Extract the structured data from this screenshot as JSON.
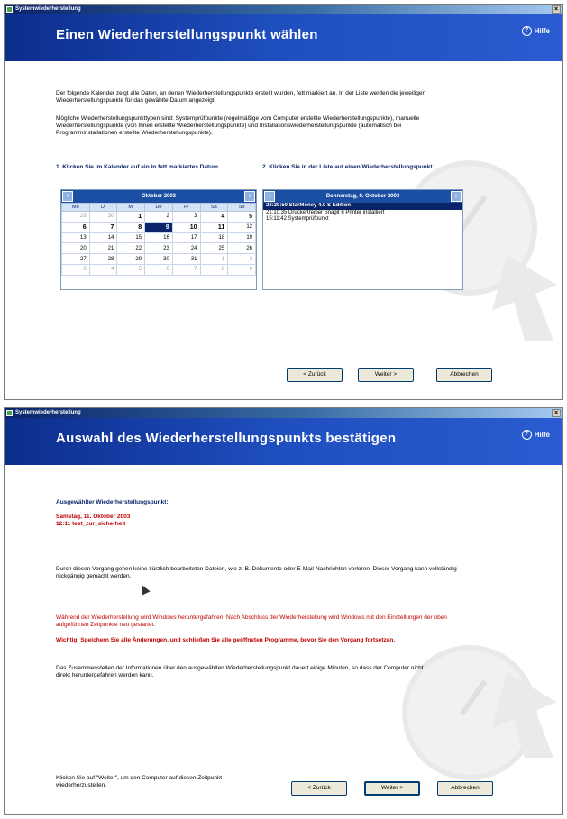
{
  "window1": {
    "titlebar": "Systemwiederherstellung",
    "close": "×",
    "header_title": "Einen Wiederherstellungspunkt wählen",
    "help_label": "Hilfe",
    "intro1": "Der folgende Kalender zeigt alle Daten, an denen Wiederherstellungspunkte erstellt wurden, fett markiert an. In der Liste werden die jeweiligen Wiederherstellungspunkte für das gewählte Datum angezeigt.",
    "intro2": "Mögliche Wiederherstellungspunkttypen sind: Systemprüfpunkte (regelmäßige vom Computer erstellte Wiederherstellungspunkte), manuelle Wiederherstellungspunkte (von Ihnen erstellte Wiederherstellungspunkte) und Installationswiederherstellungspunkte (automatisch bei Programminstallationen erstellte Wiederherstellungspunkte).",
    "step1": "1. Klicken Sie im Kalender auf ein in fett markiertes Datum.",
    "step2": "2. Klicken Sie in der Liste auf einen Wiederherstellungspunkt.",
    "calendar": {
      "month": "Oktober 2003",
      "prev": "‹",
      "next": "›",
      "weekdays": [
        "Mo",
        "Di",
        "Mi",
        "Do",
        "Fr",
        "Sa",
        "So"
      ],
      "weeks": [
        [
          "29",
          "30",
          "1",
          "2",
          "3",
          "4",
          "5"
        ],
        [
          "6",
          "7",
          "8",
          "9",
          "10",
          "11",
          "12"
        ],
        [
          "13",
          "14",
          "15",
          "16",
          "17",
          "18",
          "19"
        ],
        [
          "20",
          "21",
          "22",
          "23",
          "24",
          "25",
          "26"
        ],
        [
          "27",
          "28",
          "29",
          "30",
          "31",
          "1",
          "2"
        ],
        [
          "3",
          "4",
          "5",
          "6",
          "7",
          "8",
          "9"
        ]
      ]
    },
    "list": {
      "date": "Donnerstag, 9. Oktober 2003",
      "items": [
        "23:29:50  StarMoney 4.0 S Edition",
        "21:10:35  Druckertreiber Snagit 6 Printer installiert",
        "15:11:42  Systemprüfpunkt"
      ]
    },
    "buttons": {
      "back": "< Zurück",
      "next": "Weiter >",
      "cancel": "Abbrechen"
    }
  },
  "window2": {
    "titlebar": "Systemwiederherstellung",
    "close": "×",
    "header_title": "Auswahl des Wiederherstellungspunkts bestätigen",
    "help_label": "Hilfe",
    "selected_heading": "Ausgewählter Wiederherstellungspunkt:",
    "selected_date": "Samstag, 11. Oktober 2003",
    "selected_point": "12:11 test_zur_sicherheit",
    "para1": "Durch diesen Vorgang gehen keine kürzlich bearbeiteten Dateien, wie z. B. Dokumente oder E-Mail-Nachrichten verloren. Dieser Vorgang kann vollständig rückgängig gemacht werden.",
    "para2": "Während der Wiederherstellung wird Windows heruntergefahren. Nach Abschluss der Wiederherstellung wird Windows mit den Einstellungen der oben aufgeführten Zeitpunkte neu gestartet.",
    "para3": "Wichtig: Speichern Sie alle Änderungen, und schließen Sie alle geöffneten Programme, bevor Sie den Vorgang fortsetzen.",
    "para4": "Das Zusammenstellen der Informationen über den ausgewählten Wiederherstellungspunkt dauert einige Minuten, so dass der Computer nicht direkt heruntergefahren werden kann.",
    "footer": "Klicken Sie auf \"Weiter\", um den Computer auf diesen Zeitpunkt wiederherzustellen.",
    "buttons": {
      "back": "< Zurück",
      "next": "Weiter >",
      "cancel": "Abbrechen"
    }
  }
}
